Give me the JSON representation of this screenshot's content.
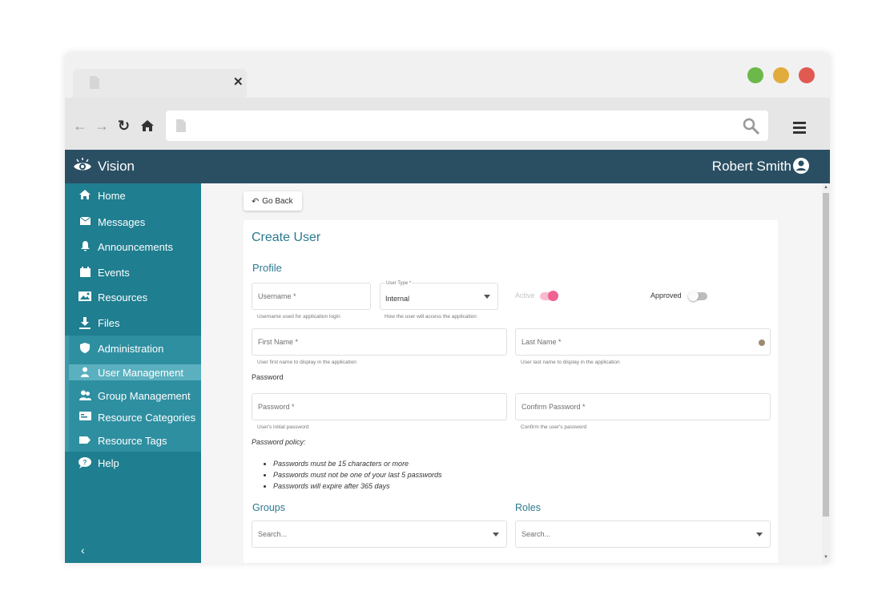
{
  "browser": {
    "traffic_colors": [
      "#6cb84a",
      "#e0ac3c",
      "#e05a52"
    ]
  },
  "app": {
    "name": "Vision",
    "user": "Robert Smith"
  },
  "sidebar": {
    "items": [
      {
        "label": "Home",
        "icon": "home-icon"
      },
      {
        "label": "Messages",
        "icon": "envelope-icon"
      },
      {
        "label": "Announcements",
        "icon": "bell-icon"
      },
      {
        "label": "Events",
        "icon": "calendar-icon"
      },
      {
        "label": "Resources",
        "icon": "image-icon"
      },
      {
        "label": "Files",
        "icon": "download-icon"
      },
      {
        "label": "Administration",
        "icon": "shield-icon"
      },
      {
        "label": "User Management",
        "icon": "user-icon"
      },
      {
        "label": "Group Management",
        "icon": "users-icon"
      },
      {
        "label": "Resource Categories",
        "icon": "id-card-icon"
      },
      {
        "label": "Resource Tags",
        "icon": "tag-icon"
      },
      {
        "label": "Help",
        "icon": "help-bubble-icon"
      }
    ]
  },
  "page": {
    "go_back": "Go Back",
    "title": "Create User",
    "profile_heading": "Profile",
    "username": {
      "placeholder": "Username *",
      "helper": "Username used for application login"
    },
    "user_type": {
      "label": "User Type *",
      "value": "Internal",
      "helper": "How the user will access the application"
    },
    "active_label": "Active",
    "approved_label": "Approved",
    "first_name": {
      "placeholder": "First Name *",
      "helper": "User first name to display in the application"
    },
    "last_name": {
      "placeholder": "Last Name *",
      "helper": "User last name to display in the application"
    },
    "password_heading": "Password",
    "password": {
      "placeholder": "Password *",
      "helper": "User's initial password"
    },
    "confirm_password": {
      "placeholder": "Confirm Password *",
      "helper": "Confirm the user's password"
    },
    "policy_title": "Password policy:",
    "policy_items": [
      "Passwords must be 15 characters or more",
      "Passwords must not be one of your last 5 passwords",
      "Passwords will expire after 365 days"
    ],
    "groups_heading": "Groups",
    "roles_heading": "Roles",
    "groups_search": "Search...",
    "roles_search": "Search..."
  },
  "colors": {
    "header": "#2a4f63",
    "sidebar": "#1f7e90",
    "accent": "#2a7a90",
    "toggle_active": "#f06292"
  }
}
